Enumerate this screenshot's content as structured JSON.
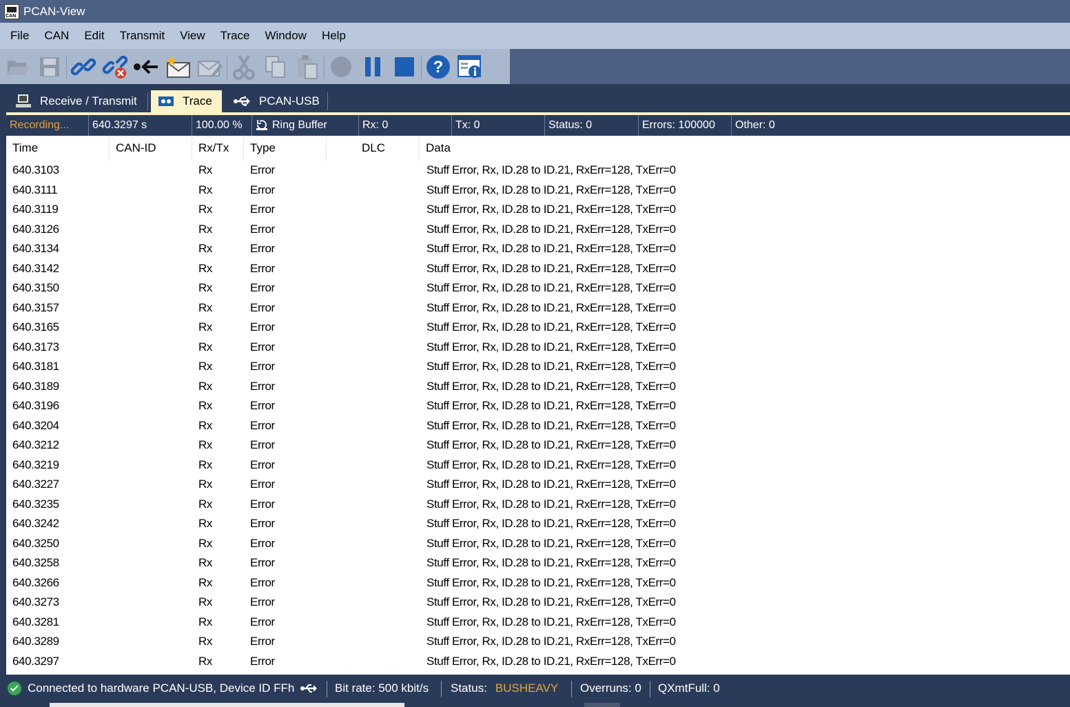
{
  "window": {
    "title": "PCAN-View"
  },
  "menu": [
    "File",
    "CAN",
    "Edit",
    "Transmit",
    "View",
    "Trace",
    "Window",
    "Help"
  ],
  "toolbar": [
    "open-file-icon",
    "save-icon",
    "connect-icon",
    "disconnect-icon",
    "reset-icon",
    "new-message-icon",
    "edit-message-icon",
    "cut-icon",
    "copy-icon",
    "paste-icon",
    "record-icon",
    "pause-icon",
    "stop-icon",
    "help-icon",
    "info-icon"
  ],
  "tabs": [
    {
      "label": "Receive / Transmit",
      "icon": "monitor-icon"
    },
    {
      "label": "Trace",
      "icon": "tape-icon",
      "active": true
    },
    {
      "label": "PCAN-USB",
      "icon": "usb-icon"
    }
  ],
  "stats": {
    "recording": "Recording...",
    "time": "640.3297 s",
    "buffer_percent": "100.00 %",
    "buffer_mode": "Ring Buffer",
    "rx": "Rx: 0",
    "tx": "Tx: 0",
    "status": "Status: 0",
    "errors": "Errors: 100000",
    "other": "Other: 0"
  },
  "columns": [
    "Time",
    "CAN-ID",
    "Rx/Tx",
    "Type",
    "DLC",
    "Data"
  ],
  "rows": [
    {
      "time": "640.3103",
      "can_id": "",
      "dir": "Rx",
      "type": "Error",
      "dlc": "",
      "data": "Stuff Error, Rx, ID.28 to ID.21, RxErr=128, TxErr=0"
    },
    {
      "time": "640.3111",
      "can_id": "",
      "dir": "Rx",
      "type": "Error",
      "dlc": "",
      "data": "Stuff Error, Rx, ID.28 to ID.21, RxErr=128, TxErr=0"
    },
    {
      "time": "640.3119",
      "can_id": "",
      "dir": "Rx",
      "type": "Error",
      "dlc": "",
      "data": "Stuff Error, Rx, ID.28 to ID.21, RxErr=128, TxErr=0"
    },
    {
      "time": "640.3126",
      "can_id": "",
      "dir": "Rx",
      "type": "Error",
      "dlc": "",
      "data": "Stuff Error, Rx, ID.28 to ID.21, RxErr=128, TxErr=0"
    },
    {
      "time": "640.3134",
      "can_id": "",
      "dir": "Rx",
      "type": "Error",
      "dlc": "",
      "data": "Stuff Error, Rx, ID.28 to ID.21, RxErr=128, TxErr=0"
    },
    {
      "time": "640.3142",
      "can_id": "",
      "dir": "Rx",
      "type": "Error",
      "dlc": "",
      "data": "Stuff Error, Rx, ID.28 to ID.21, RxErr=128, TxErr=0"
    },
    {
      "time": "640.3150",
      "can_id": "",
      "dir": "Rx",
      "type": "Error",
      "dlc": "",
      "data": "Stuff Error, Rx, ID.28 to ID.21, RxErr=128, TxErr=0"
    },
    {
      "time": "640.3157",
      "can_id": "",
      "dir": "Rx",
      "type": "Error",
      "dlc": "",
      "data": "Stuff Error, Rx, ID.28 to ID.21, RxErr=128, TxErr=0"
    },
    {
      "time": "640.3165",
      "can_id": "",
      "dir": "Rx",
      "type": "Error",
      "dlc": "",
      "data": "Stuff Error, Rx, ID.28 to ID.21, RxErr=128, TxErr=0"
    },
    {
      "time": "640.3173",
      "can_id": "",
      "dir": "Rx",
      "type": "Error",
      "dlc": "",
      "data": "Stuff Error, Rx, ID.28 to ID.21, RxErr=128, TxErr=0"
    },
    {
      "time": "640.3181",
      "can_id": "",
      "dir": "Rx",
      "type": "Error",
      "dlc": "",
      "data": "Stuff Error, Rx, ID.28 to ID.21, RxErr=128, TxErr=0"
    },
    {
      "time": "640.3189",
      "can_id": "",
      "dir": "Rx",
      "type": "Error",
      "dlc": "",
      "data": "Stuff Error, Rx, ID.28 to ID.21, RxErr=128, TxErr=0"
    },
    {
      "time": "640.3196",
      "can_id": "",
      "dir": "Rx",
      "type": "Error",
      "dlc": "",
      "data": "Stuff Error, Rx, ID.28 to ID.21, RxErr=128, TxErr=0"
    },
    {
      "time": "640.3204",
      "can_id": "",
      "dir": "Rx",
      "type": "Error",
      "dlc": "",
      "data": "Stuff Error, Rx, ID.28 to ID.21, RxErr=128, TxErr=0"
    },
    {
      "time": "640.3212",
      "can_id": "",
      "dir": "Rx",
      "type": "Error",
      "dlc": "",
      "data": "Stuff Error, Rx, ID.28 to ID.21, RxErr=128, TxErr=0"
    },
    {
      "time": "640.3219",
      "can_id": "",
      "dir": "Rx",
      "type": "Error",
      "dlc": "",
      "data": "Stuff Error, Rx, ID.28 to ID.21, RxErr=128, TxErr=0"
    },
    {
      "time": "640.3227",
      "can_id": "",
      "dir": "Rx",
      "type": "Error",
      "dlc": "",
      "data": "Stuff Error, Rx, ID.28 to ID.21, RxErr=128, TxErr=0"
    },
    {
      "time": "640.3235",
      "can_id": "",
      "dir": "Rx",
      "type": "Error",
      "dlc": "",
      "data": "Stuff Error, Rx, ID.28 to ID.21, RxErr=128, TxErr=0"
    },
    {
      "time": "640.3242",
      "can_id": "",
      "dir": "Rx",
      "type": "Error",
      "dlc": "",
      "data": "Stuff Error, Rx, ID.28 to ID.21, RxErr=128, TxErr=0"
    },
    {
      "time": "640.3250",
      "can_id": "",
      "dir": "Rx",
      "type": "Error",
      "dlc": "",
      "data": "Stuff Error, Rx, ID.28 to ID.21, RxErr=128, TxErr=0"
    },
    {
      "time": "640.3258",
      "can_id": "",
      "dir": "Rx",
      "type": "Error",
      "dlc": "",
      "data": "Stuff Error, Rx, ID.28 to ID.21, RxErr=128, TxErr=0"
    },
    {
      "time": "640.3266",
      "can_id": "",
      "dir": "Rx",
      "type": "Error",
      "dlc": "",
      "data": "Stuff Error, Rx, ID.28 to ID.21, RxErr=128, TxErr=0"
    },
    {
      "time": "640.3273",
      "can_id": "",
      "dir": "Rx",
      "type": "Error",
      "dlc": "",
      "data": "Stuff Error, Rx, ID.28 to ID.21, RxErr=128, TxErr=0"
    },
    {
      "time": "640.3281",
      "can_id": "",
      "dir": "Rx",
      "type": "Error",
      "dlc": "",
      "data": "Stuff Error, Rx, ID.28 to ID.21, RxErr=128, TxErr=0"
    },
    {
      "time": "640.3289",
      "can_id": "",
      "dir": "Rx",
      "type": "Error",
      "dlc": "",
      "data": "Stuff Error, Rx, ID.28 to ID.21, RxErr=128, TxErr=0"
    },
    {
      "time": "640.3297",
      "can_id": "",
      "dir": "Rx",
      "type": "Error",
      "dlc": "",
      "data": "Stuff Error, Rx, ID.28 to ID.21, RxErr=128, TxErr=0"
    }
  ],
  "statusbar": {
    "connection": "Connected to hardware PCAN-USB, Device ID FFh",
    "bitrate": "Bit rate: 500 kbit/s",
    "status_label": "Status:",
    "status_value": "BUSHEAVY",
    "overruns": "Overruns: 0",
    "qxmtfull": "QXmtFull: 0"
  },
  "colors": {
    "accent_status": "#e5a23a",
    "recording": "#e5a23a",
    "dark_panel": "#2a3b5a",
    "title_bar": "#4d6184",
    "active_tab": "#fdf3c8",
    "connected_ok": "#3aa655"
  }
}
